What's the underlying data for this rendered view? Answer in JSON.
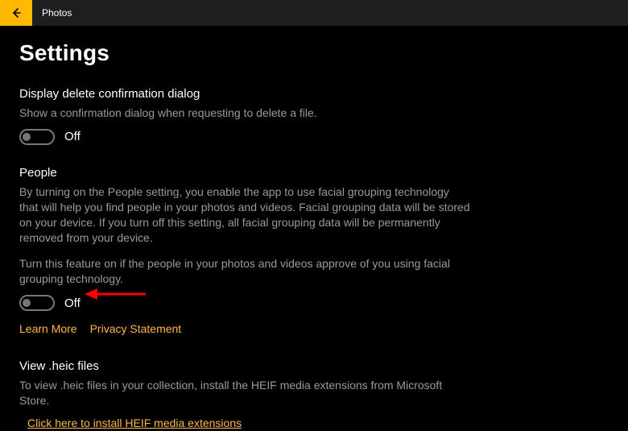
{
  "titlebar": {
    "app_title": "Photos"
  },
  "page": {
    "title": "Settings"
  },
  "sections": {
    "delete_confirm": {
      "title": "Display delete confirmation dialog",
      "desc": "Show a confirmation dialog when requesting to delete a file.",
      "toggle_state": "Off"
    },
    "people": {
      "title": "People",
      "desc": "By turning on the People setting, you enable the app to use facial grouping technology that will help you find people in your photos and videos. Facial grouping data will be stored on your device. If you turn off this setting, all facial grouping data will be permanently removed from your device.",
      "desc2": "Turn this feature on if the people in your photos and videos approve of you using facial grouping technology.",
      "toggle_state": "Off",
      "links": {
        "learn_more": "Learn More",
        "privacy": "Privacy Statement"
      }
    },
    "heic": {
      "title": "View .heic files",
      "desc": "To view .heic files in your collection, install the HEIF media extensions from Microsoft Store.",
      "link": "Click here to install HEIF media extensions"
    }
  }
}
